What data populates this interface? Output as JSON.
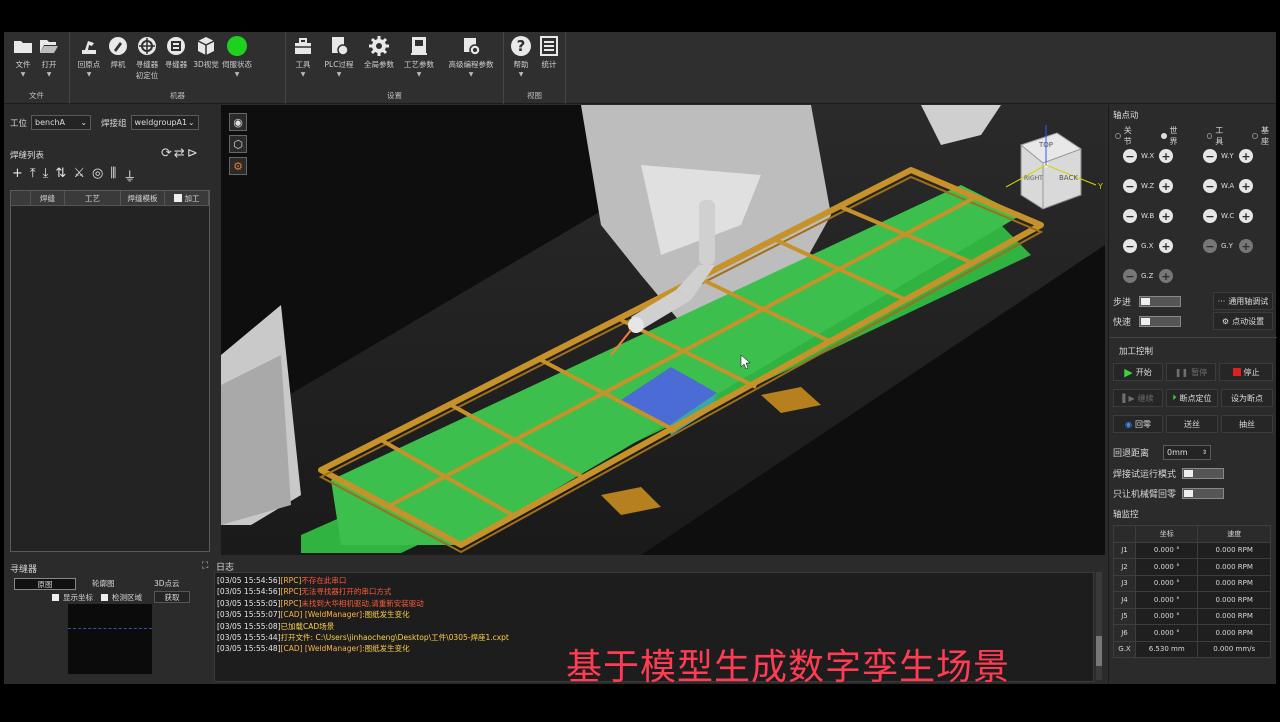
{
  "toolbar": {
    "groups": [
      {
        "title": "文件",
        "buttons": [
          {
            "label": "文件",
            "icon": "folder-icon"
          },
          {
            "label": "打开",
            "icon": "open-folder-icon"
          }
        ]
      },
      {
        "title": "机器",
        "buttons": [
          {
            "label": "回原点",
            "icon": "robot-home-icon"
          },
          {
            "label": "焊机",
            "icon": "welder-icon"
          },
          {
            "label": "寻缝器初定位",
            "label_line1": "寻缝器",
            "label_line2": "初定位",
            "icon": "seeker-init-icon"
          },
          {
            "label": "寻缝器",
            "icon": "seeker-icon"
          },
          {
            "label": "3D视觉",
            "icon": "cube-3d-icon"
          },
          {
            "label": "伺服状态",
            "icon": "servo-status-icon"
          }
        ]
      },
      {
        "title": "设置",
        "buttons": [
          {
            "label": "工具",
            "icon": "toolbox-icon"
          },
          {
            "label": "PLC过程",
            "icon": "plc-icon"
          },
          {
            "label": "全局参数",
            "icon": "gear-icon"
          },
          {
            "label": "工艺参数",
            "icon": "process-params-icon"
          },
          {
            "label": "高级编程参数",
            "icon": "advanced-params-icon"
          }
        ]
      },
      {
        "title": "视图",
        "buttons": [
          {
            "label": "帮助",
            "icon": "help-icon"
          },
          {
            "label": "统计",
            "icon": "statistics-icon"
          }
        ]
      }
    ],
    "servo_color": "#1fd11f"
  },
  "left": {
    "station_label": "工位",
    "station_value": "benchA",
    "weldgroup_label": "焊接组",
    "weldgroup_value": "weldgroupA1",
    "list_title": "焊缝列表",
    "columns": [
      "焊缝",
      "工艺",
      "焊缝模板",
      "加工"
    ]
  },
  "right": {
    "jog_title": "轴点动",
    "coord_modes": [
      "关节",
      "世界",
      "工具",
      "基座"
    ],
    "coord_selected": "世界",
    "axes": [
      "W.X",
      "W.Y",
      "W.Z",
      "W.A",
      "W.B",
      "W.C",
      "G.X",
      "G.Y",
      "G.Z"
    ],
    "step_label": "步进",
    "fast_label": "快速",
    "general_jog_label": "通用轴调试",
    "jog_settings_label": "点动设置",
    "process_title": "加工控制",
    "btn_start": "开始",
    "btn_pause": "暂停",
    "btn_stop": "停止",
    "btn_continue": "继续",
    "btn_breakpoint_locate": "断点定位",
    "btn_set_breakpoint": "设为断点",
    "btn_home": "回零",
    "btn_feed_wire": "送丝",
    "btn_draw_wire": "抽丝",
    "retract_label": "回退距离",
    "retract_value": "0mm",
    "trial_label": "焊接试运行模式",
    "robot_only_label": "只让机械臂回零",
    "monitor_title": "轴监控",
    "monitor_cols": [
      "坐标",
      "速度"
    ],
    "monitor_rows": [
      {
        "axis": "J1",
        "coord": "0.000 °",
        "speed": "0.000 RPM"
      },
      {
        "axis": "J2",
        "coord": "0.000 °",
        "speed": "0.000 RPM"
      },
      {
        "axis": "J3",
        "coord": "0.000 °",
        "speed": "0.000 RPM"
      },
      {
        "axis": "J4",
        "coord": "0.000 °",
        "speed": "0.000 RPM"
      },
      {
        "axis": "J5",
        "coord": "0.000 °",
        "speed": "0.000 RPM"
      },
      {
        "axis": "J6",
        "coord": "0.000 °",
        "speed": "0.000 RPM"
      },
      {
        "axis": "G.X",
        "coord": "6.530 mm",
        "speed": "0.000 mm/s"
      }
    ]
  },
  "seeker": {
    "title": "寻缝器",
    "tabs": [
      "原图",
      "轮廓图",
      "3D点云"
    ],
    "show_coords": "显示坐标",
    "detect_region": "检测区域",
    "capture": "获取"
  },
  "log": {
    "title": "日志",
    "lines": [
      {
        "time": "[03/05 15:54:56]",
        "tag": "[RPC]",
        "msg": "不存在此串口",
        "color": "r"
      },
      {
        "time": "[03/05 15:54:56]",
        "tag": "[RPC]",
        "msg": "无法寻找器打开的串口方式",
        "color": "r"
      },
      {
        "time": "[03/05 15:55:05]",
        "tag": "[RPC]",
        "msg": "未找到大华相机驱动,请重新安装驱动",
        "color": "r"
      },
      {
        "time": "[03/05 15:55:07]",
        "tag": "[CAD] [WeldManager]:",
        "msg": "图纸发生变化",
        "color": "y"
      },
      {
        "time": "[03/05 15:55:08]",
        "tag": "",
        "msg": "已加载CAD场景",
        "color": "y"
      },
      {
        "time": "[03/05 15:55:44]",
        "tag": "",
        "msg": "打开文件: C:\\Users\\jinhaocheng\\Desktop\\工件\\0305-焊座1.cxpt",
        "color": "y"
      },
      {
        "time": "[03/05 15:55:48]",
        "tag": "[CAD] [WeldManager]:",
        "msg": "图纸发生变化",
        "color": "y"
      }
    ]
  },
  "overlay_caption": "基于模型生成数字孪生场景",
  "viewcube": {
    "top": "TOP",
    "right": "BACK",
    "left": "RIGHT"
  },
  "colors": {
    "frame": "#c8922a",
    "floor": "#35b84a",
    "accent_stop": "#e02020",
    "play": "#3fd13f"
  }
}
